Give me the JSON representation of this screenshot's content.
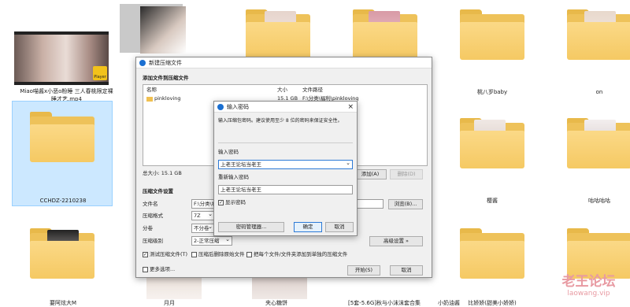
{
  "explorer": {
    "items": [
      {
        "label": "Miao喵酱x小恶o粉睡 三人春桃限定裸睡才艺.mp4",
        "badge": "Player"
      },
      {
        "label": "CCHDZ-2210238"
      },
      {
        "label": "要阿炫大M"
      },
      {
        "label": "月月"
      },
      {
        "label": "夹心糖饼"
      },
      {
        "label": "[5套-5.6G]秋与小沫沫套合集"
      },
      {
        "label": "小奶油酱"
      },
      {
        "label": "比娇娇(甜美小娇娇)"
      },
      {
        "label": "桃八岁baby"
      },
      {
        "label": "on"
      },
      {
        "label": "樱酱"
      },
      {
        "label": "咕咕咕咕"
      }
    ],
    "watermark": {
      "cn": "老王论坛",
      "url": "laowang.vip"
    }
  },
  "archive_dialog": {
    "title": "新建压缩文件",
    "add_files_label": "添加文件到压缩文件",
    "columns": {
      "name": "名称",
      "size": "大小",
      "path": "文件路径"
    },
    "file_row": {
      "name": "pinkloving",
      "size": "15.1 GB",
      "path": "F:\\分类\\福利\\pinkloving"
    },
    "total": "总大小: 15.1 GB",
    "add_btn": "添加(A)",
    "delete_btn": "删除(D)",
    "settings_header": "压缩文件设置",
    "filename_label": "文件名",
    "filename_value": "F:\\分类\\福",
    "browse_btn": "浏览(B)...",
    "format_label": "压缩格式",
    "format_value": "7Z",
    "split_label": "分卷",
    "split_value": "不分卷",
    "level_label": "压缩级别",
    "level_value": "2-正常压缩",
    "advanced_btn": "高级设置 »",
    "opt_test": "测试压缩文件(T)",
    "opt_delete": "压缩后删除原始文件",
    "opt_each": "把每个文件/文件夹添加到单独的压缩文件",
    "more_options": "更多选项...",
    "start_btn": "开始(S)",
    "cancel_btn": "取消"
  },
  "password_dialog": {
    "title": "输入密码",
    "instruction": "输入压缩包密码。建议使用至少 8 位的密码来保证安全性。",
    "enter_label": "输入密码",
    "enter_value": "上老王论坛当老王",
    "reenter_label": "重新输入密码",
    "reenter_value": "上老王论坛当老王",
    "show_password": "显示密码",
    "manager_btn": "密码管理器...",
    "ok_btn": "确定",
    "cancel_btn": "取消",
    "close_icon": "×"
  }
}
